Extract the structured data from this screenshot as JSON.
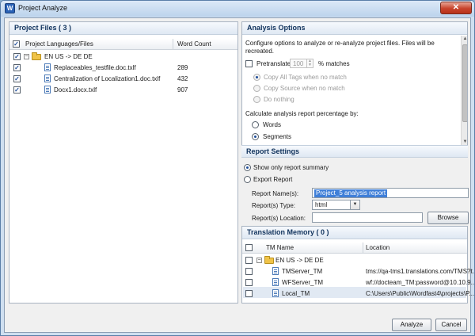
{
  "window": {
    "title": "Project Analyze",
    "close_glyph": "✕",
    "app_icon": "W"
  },
  "project_files": {
    "title": "Project Files ( 3 )",
    "columns": [
      "Project Languages/Files",
      "Word Count"
    ],
    "group": "EN US -> DE DE",
    "files": [
      {
        "name": "Replaceables_testfile.doc.txlf",
        "count": "289"
      },
      {
        "name": "Centralization of Localization1.doc.txlf",
        "count": "432"
      },
      {
        "name": "Docx1.docx.txlf",
        "count": "907"
      }
    ]
  },
  "analysis": {
    "title": "Analysis Options",
    "description": "Configure options to analyze or re-analyze project files. Files will be recreated.",
    "pretranslate_label": "Pretranslate",
    "pretranslate_value": "100",
    "matches_label": "% matches",
    "copy_tags": "Copy All Tags when no match",
    "copy_source": "Copy Source when no match",
    "do_nothing": "Do nothing",
    "calc_label": "Calculate analysis report percentage by:",
    "words": "Words",
    "segments": "Segments"
  },
  "report": {
    "title": "Report Settings",
    "summary": "Show only report summary",
    "export": "Export Report",
    "name_label": "Report Name(s):",
    "name_value": "Project_5 analysis report",
    "type_label": "Report(s) Type:",
    "type_value": "html",
    "location_label": "Report(s) Location:",
    "browse": "Browse"
  },
  "tm": {
    "title": "Translation Memory ( 0 )",
    "columns": [
      "TM Name",
      "Location"
    ],
    "group": "EN US -> DE DE",
    "items": [
      {
        "name": "TMServer_TM",
        "location": "tms://qa-tms1.translations.com/TMS?t..."
      },
      {
        "name": "WFServer_TM",
        "location": "wf://docteam_TM:password@10.10.9..."
      },
      {
        "name": "Local_TM",
        "location": "C:\\Users\\Public\\Wordfast4\\projects\\P..."
      }
    ]
  },
  "footer": {
    "analyze": "Analyze",
    "cancel": "Cancel"
  }
}
